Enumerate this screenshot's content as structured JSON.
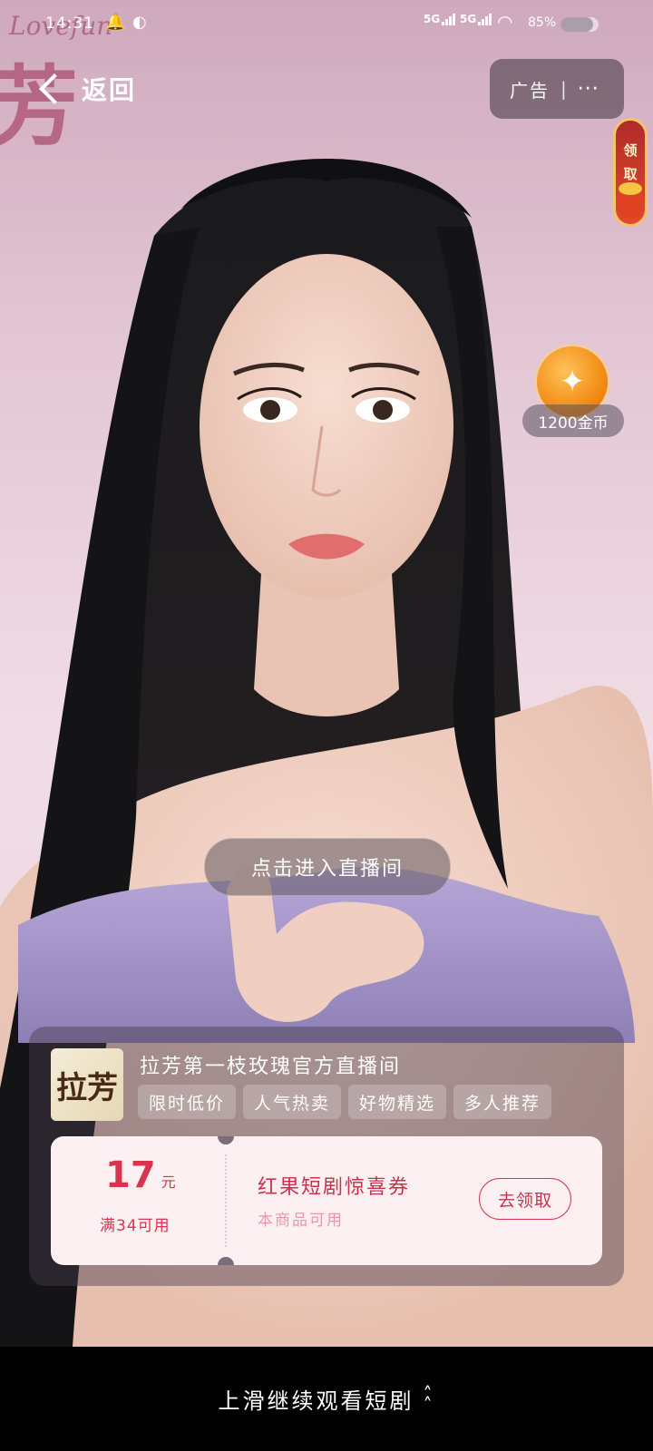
{
  "status_bar": {
    "time": "14:31",
    "signal1": "5G",
    "signal2": "5G",
    "battery": "85%"
  },
  "nav": {
    "back_label": "返回"
  },
  "ad_capsule": {
    "ad_label": "广告",
    "separator": "|",
    "more": "···"
  },
  "claim_badge": {
    "label": "领取"
  },
  "coin_reward": {
    "label": "1200金币",
    "icon": "sparkle-icon"
  },
  "brand_watermark": {
    "text": "芳"
  },
  "enter_live": {
    "label": "点击进入直播间"
  },
  "shop": {
    "logo_text": "拉芳",
    "name": "拉芳第一枝玫瑰官方直播间",
    "tags": [
      "限时低价",
      "人气热卖",
      "好物精选",
      "多人推荐"
    ]
  },
  "coupon": {
    "amount": "17",
    "unit": "元",
    "condition": "满34可用",
    "title": "红果短剧惊喜券",
    "subtitle": "本商品可用",
    "button": "去领取"
  },
  "swipe_hint": {
    "label": "上滑继续观看短剧"
  },
  "colors": {
    "accent": "#d9344f",
    "coin": "#f0850a",
    "background": "#ecd7e1"
  }
}
